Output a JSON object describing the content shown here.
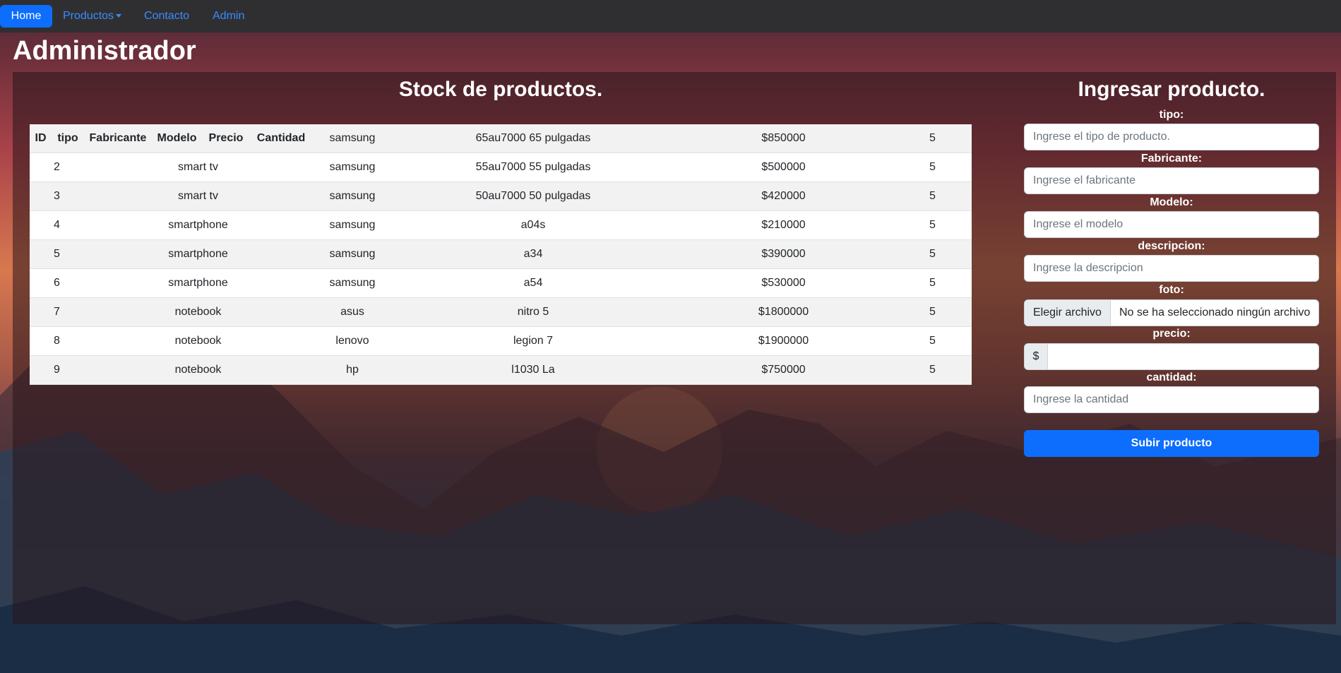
{
  "nav": {
    "items": [
      {
        "label": "Home"
      },
      {
        "label": "Productos"
      },
      {
        "label": "Contacto"
      },
      {
        "label": "Admin"
      }
    ]
  },
  "page": {
    "title": "Administrador"
  },
  "stock": {
    "title": "Stock de productos.",
    "headers": [
      "ID",
      "tipo",
      "Fabricante",
      "Modelo",
      "Precio",
      "Cantidad"
    ],
    "rows": [
      {
        "id": "",
        "tipo": "",
        "fabricante": "samsung",
        "modelo": "65au7000 65 pulgadas",
        "precio": "$850000",
        "cantidad": "5"
      },
      {
        "id": "2",
        "tipo": "smart tv",
        "fabricante": "samsung",
        "modelo": "55au7000 55 pulgadas",
        "precio": "$500000",
        "cantidad": "5"
      },
      {
        "id": "3",
        "tipo": "smart tv",
        "fabricante": "samsung",
        "modelo": "50au7000 50 pulgadas",
        "precio": "$420000",
        "cantidad": "5"
      },
      {
        "id": "4",
        "tipo": "smartphone",
        "fabricante": "samsung",
        "modelo": "a04s",
        "precio": "$210000",
        "cantidad": "5"
      },
      {
        "id": "5",
        "tipo": "smartphone",
        "fabricante": "samsung",
        "modelo": "a34",
        "precio": "$390000",
        "cantidad": "5"
      },
      {
        "id": "6",
        "tipo": "smartphone",
        "fabricante": "samsung",
        "modelo": "a54",
        "precio": "$530000",
        "cantidad": "5"
      },
      {
        "id": "7",
        "tipo": "notebook",
        "fabricante": "asus",
        "modelo": "nitro 5",
        "precio": "$1800000",
        "cantidad": "5"
      },
      {
        "id": "8",
        "tipo": "notebook",
        "fabricante": "lenovo",
        "modelo": "legion 7",
        "precio": "$1900000",
        "cantidad": "5"
      },
      {
        "id": "9",
        "tipo": "notebook",
        "fabricante": "hp",
        "modelo": "l1030 La",
        "precio": "$750000",
        "cantidad": "5"
      }
    ]
  },
  "form": {
    "title": "Ingresar producto.",
    "tipo": {
      "label": "tipo:",
      "placeholder": "Ingrese el tipo de producto."
    },
    "fabricante": {
      "label": "Fabricante:",
      "placeholder": "Ingrese el fabricante"
    },
    "modelo": {
      "label": "Modelo:",
      "placeholder": "Ingrese el modelo"
    },
    "descripcion": {
      "label": "descripcion:",
      "placeholder": "Ingrese la descripcion"
    },
    "foto": {
      "label": "foto:",
      "button": "Elegir archivo",
      "status": "No se ha seleccionado ningún archivo"
    },
    "precio": {
      "label": "precio:",
      "prefix": "$"
    },
    "cantidad": {
      "label": "cantidad:",
      "placeholder": "Ingrese la cantidad"
    },
    "submit": "Subir producto"
  }
}
